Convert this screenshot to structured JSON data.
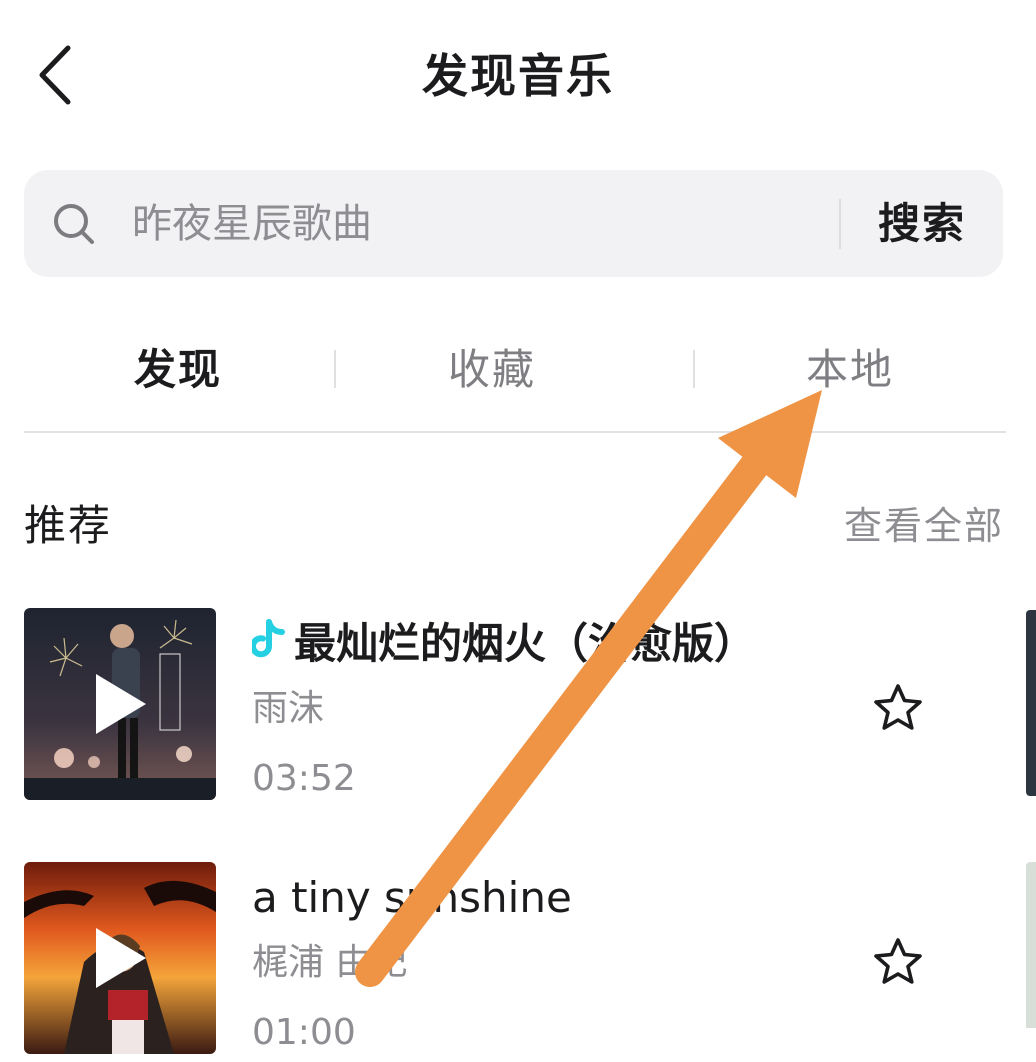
{
  "header": {
    "title": "发现音乐"
  },
  "search": {
    "placeholder": "昨夜星辰歌曲",
    "button_label": "搜索"
  },
  "tabs": [
    {
      "label": "发现",
      "active": true
    },
    {
      "label": "收藏",
      "active": false
    },
    {
      "label": "本地",
      "active": false
    }
  ],
  "section": {
    "title": "推荐",
    "more_label": "查看全部"
  },
  "songs": [
    {
      "title": "最灿烂的烟火（治愈版）",
      "artist": "雨沫",
      "duration": "03:52",
      "icon": "douyin-note-icon"
    },
    {
      "title": "a tiny sunshine",
      "artist": "梶浦 由記",
      "duration": "01:00"
    }
  ],
  "colors": {
    "accent_note": "#25d0e2",
    "arrow": "#ef9345",
    "search_bg": "#f2f2f4"
  }
}
